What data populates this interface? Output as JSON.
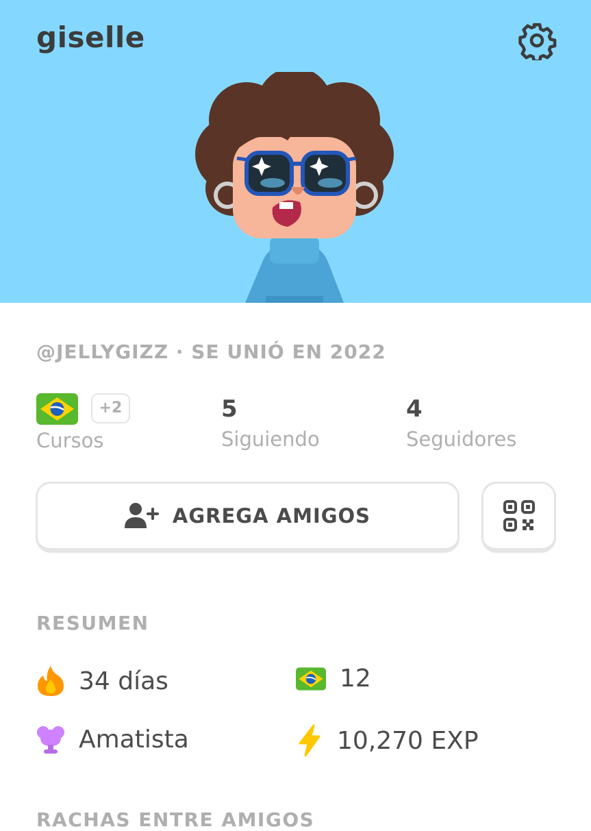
{
  "profile": {
    "name": "giselle",
    "handle_line": "@JELLYGIZZ · SE UNIÓ EN 2022"
  },
  "stats": {
    "courses_extra": "+2",
    "courses_label": "Cursos",
    "following_value": "5",
    "following_label": "Siguiendo",
    "followers_value": "4",
    "followers_label": "Seguidores"
  },
  "actions": {
    "add_friends_label": "AGREGA AMIGOS"
  },
  "summary": {
    "title": "RESUMEN",
    "streak": "34 días",
    "course_level": "12",
    "league": "Amatista",
    "xp": "10,270 EXP"
  },
  "next_section": {
    "title": "RACHAS ENTRE AMIGOS"
  },
  "colors": {
    "hero_bg": "#84d8ff",
    "muted": "#afafaf",
    "text": "#4b4b4b",
    "streak": "#ff9600",
    "league": "#ce82ff",
    "xp": "#ffc800"
  },
  "icons": [
    "gear-icon",
    "brazil-flag-icon",
    "add-user-icon",
    "qr-code-icon",
    "fire-icon",
    "trophy-icon",
    "lightning-icon"
  ]
}
